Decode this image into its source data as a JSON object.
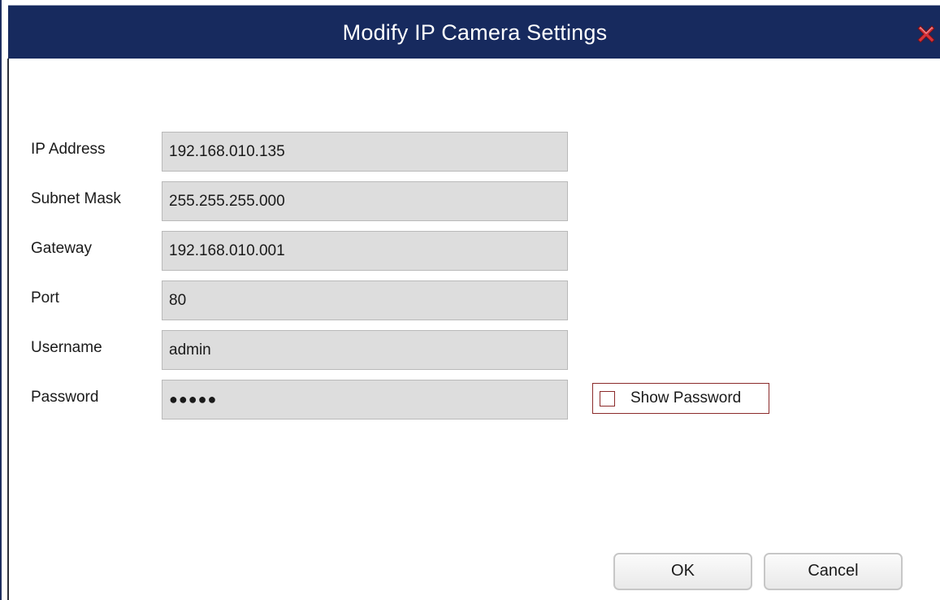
{
  "window": {
    "title": "Modify IP Camera Settings",
    "close_icon": "close-x-icon"
  },
  "form": {
    "fields": [
      {
        "label": "IP Address",
        "value": "192.168.010.135"
      },
      {
        "label": "Subnet Mask",
        "value": "255.255.255.000"
      },
      {
        "label": "Gateway",
        "value": "192.168.010.001"
      },
      {
        "label": "Port",
        "value": "80"
      },
      {
        "label": "Username",
        "value": "admin"
      },
      {
        "label": "Password",
        "value": "●●●●●"
      }
    ],
    "show_password": {
      "label": "Show Password",
      "checked": false
    }
  },
  "buttons": {
    "ok": "OK",
    "cancel": "Cancel"
  },
  "colors": {
    "titlebar": "#172a5e",
    "close_icon": "#d8333a",
    "field_bg": "#dddddd",
    "checkbox_border": "#8b2a2a"
  }
}
